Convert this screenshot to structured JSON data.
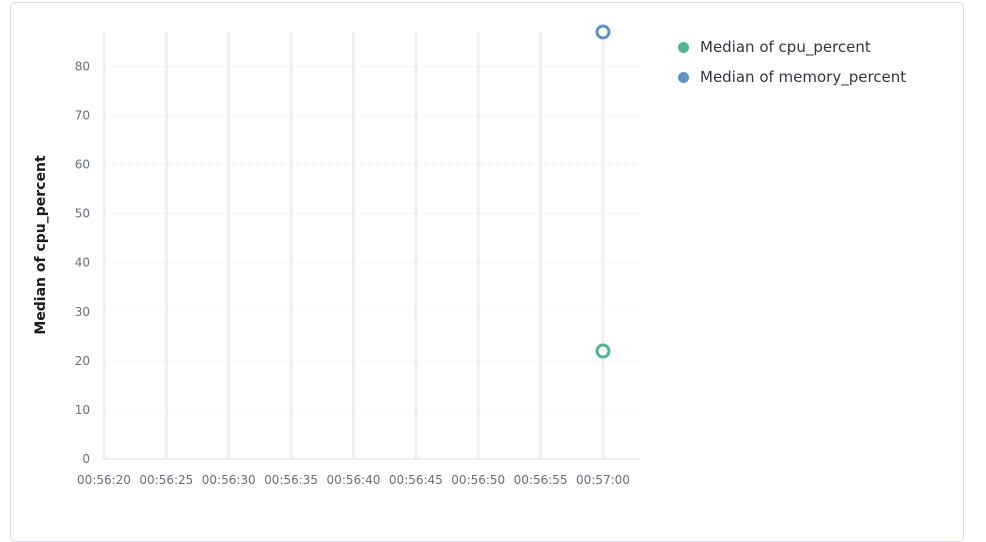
{
  "chart_data": {
    "type": "scatter",
    "title": "",
    "xlabel": "",
    "ylabel": "Median of cpu_percent",
    "x_ticks": [
      "00:56:20",
      "00:56:25",
      "00:56:30",
      "00:56:35",
      "00:56:40",
      "00:56:45",
      "00:56:50",
      "00:56:55",
      "00:57:00"
    ],
    "y_ticks": [
      0,
      10,
      20,
      30,
      40,
      50,
      60,
      70,
      80
    ],
    "ylim": [
      0,
      87
    ],
    "xlim": [
      "00:56:20",
      "00:57:03"
    ],
    "grid": true,
    "legend_position": "top-right",
    "series": [
      {
        "name": "Median of cpu_percent",
        "color": "#54b399",
        "points": [
          {
            "x": "00:57:00",
            "y": 22
          }
        ]
      },
      {
        "name": "Median of memory_percent",
        "color": "#6092c0",
        "points": [
          {
            "x": "00:57:00",
            "y": 87
          }
        ]
      }
    ]
  }
}
